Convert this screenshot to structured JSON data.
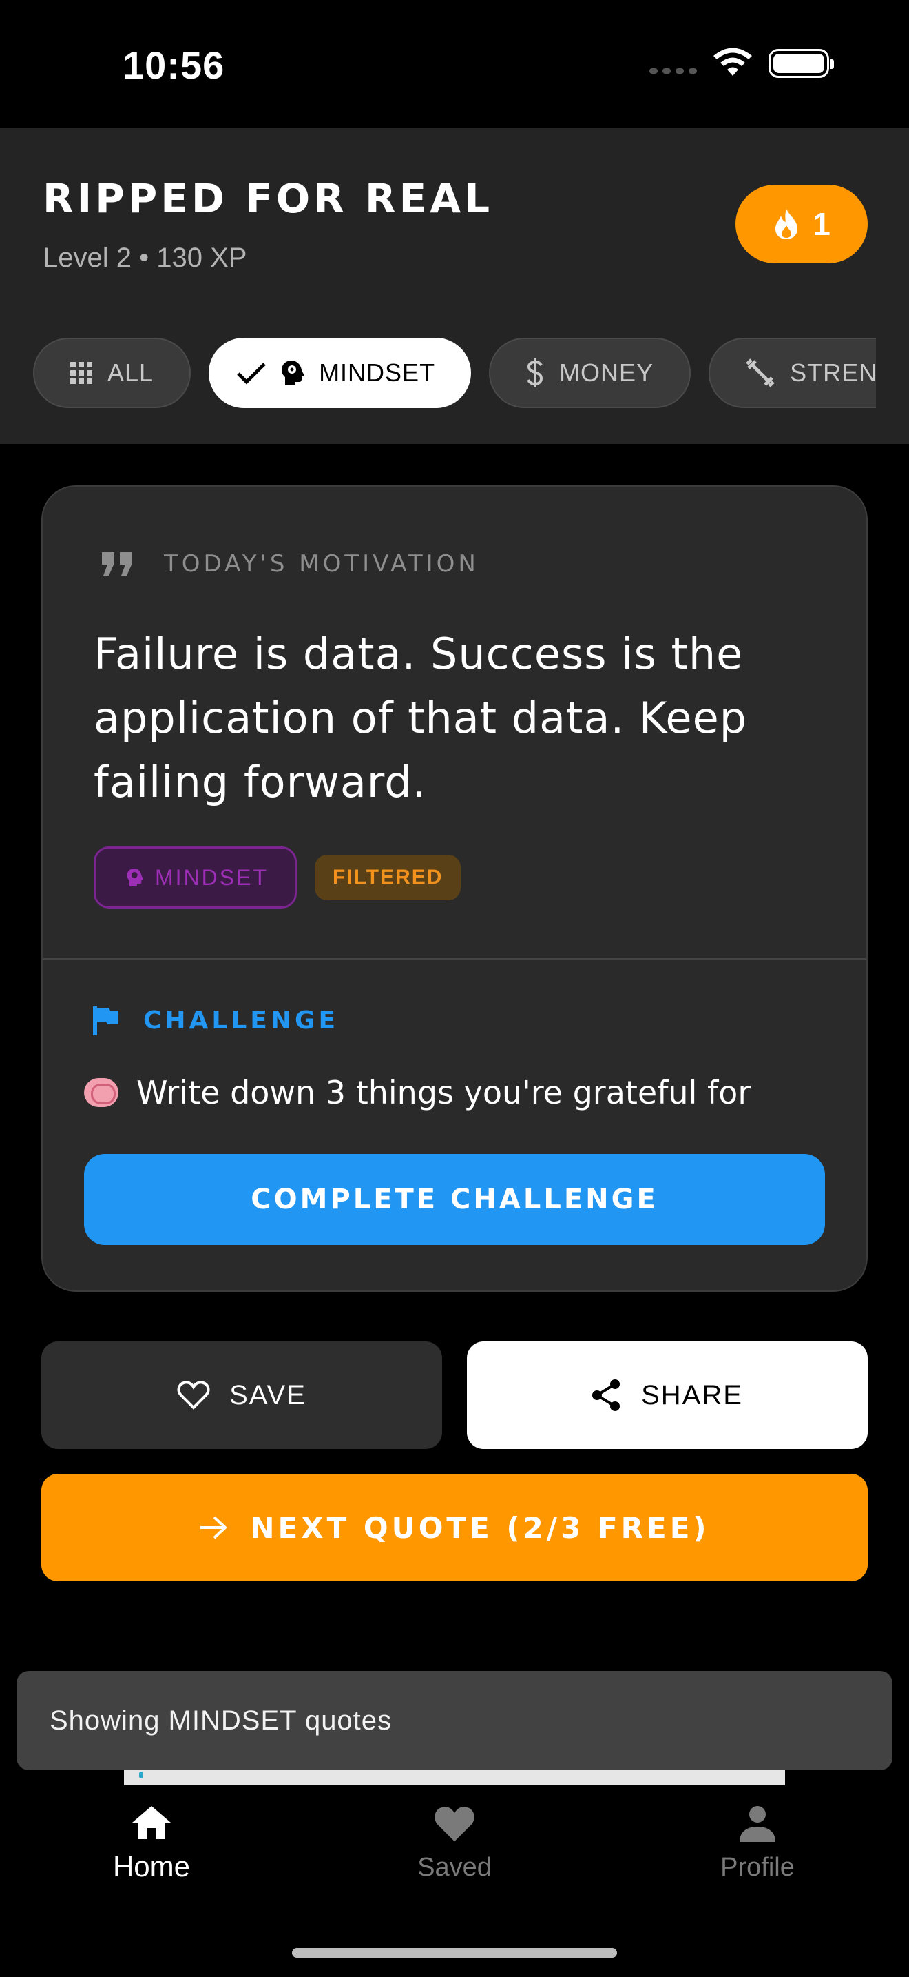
{
  "status_bar": {
    "time": "10:56"
  },
  "header": {
    "title": "RIPPED FOR REAL",
    "level_text": "Level 2 • 130 XP",
    "streak_count": "1"
  },
  "categories": [
    {
      "label": "ALL",
      "icon": "grid-icon",
      "selected": false
    },
    {
      "label": "MINDSET",
      "icon": "brain-head-icon",
      "selected": true
    },
    {
      "label": "MONEY",
      "icon": "dollar-icon",
      "selected": false
    },
    {
      "label": "STRENGTH",
      "icon": "dumbbell-icon",
      "selected": false
    }
  ],
  "quote_card": {
    "label": "TODAY'S MOTIVATION",
    "quote": "Failure is data. Success is the application of that data. Keep failing forward.",
    "category_tag": "MINDSET",
    "filtered_tag": "FILTERED",
    "challenge_label": "CHALLENGE",
    "challenge_text": "Write down 3 things you're grateful for",
    "complete_button": "COMPLETE CHALLENGE"
  },
  "actions": {
    "save": "SAVE",
    "share": "SHARE",
    "next": "NEXT QUOTE (2/3 FREE)"
  },
  "snackbar": {
    "message": "Showing MINDSET quotes"
  },
  "bottom_nav": [
    {
      "label": "Home",
      "active": true
    },
    {
      "label": "Saved",
      "active": false
    },
    {
      "label": "Profile",
      "active": false
    }
  ],
  "colors": {
    "accent_orange": "#ff9800",
    "accent_blue": "#2196f3",
    "mindset_purple": "#9c2fb5"
  }
}
